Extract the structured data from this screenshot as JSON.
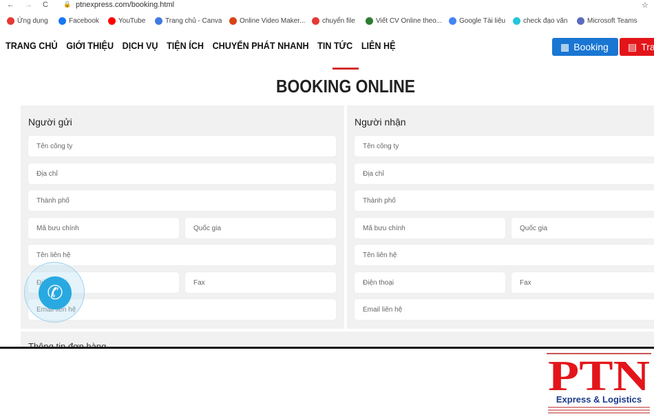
{
  "browser": {
    "url": "ptnexpress.com/booking.html"
  },
  "bookmarks": [
    {
      "label": "Ứng dụng",
      "color": "#e53935"
    },
    {
      "label": "Facebook",
      "color": "#1877f2"
    },
    {
      "label": "YouTube",
      "color": "#ff0000"
    },
    {
      "label": "Trang chủ - Canva",
      "color": "#3f7be0"
    },
    {
      "label": "Online Video Maker...",
      "color": "#d84315"
    },
    {
      "label": "chuyển file",
      "color": "#e53935"
    },
    {
      "label": "Viết CV Online theo...",
      "color": "#2e7d32"
    },
    {
      "label": "Google Tài liệu",
      "color": "#4285f4"
    },
    {
      "label": "check đạo văn",
      "color": "#26c6da"
    },
    {
      "label": "Microsoft Teams",
      "color": "#5c6bc0"
    }
  ],
  "nav": [
    "TRANG CHỦ",
    "GIỚI THIỆU",
    "DỊCH VỤ",
    "TIỆN ÍCH",
    "CHUYỂN PHÁT NHANH",
    "TIN TỨC",
    "LIÊN HỆ"
  ],
  "buttons": {
    "booking": "Booking",
    "track": "Tra"
  },
  "page_title": "BOOKING ONLINE",
  "sender": {
    "title": "Người gửi",
    "company": "Tên công ty",
    "address": "Địa chỉ",
    "city": "Thành phố",
    "postal": "Mã bưu chính",
    "country": "Quốc gia",
    "contact": "Tên liên hệ",
    "phone": "Điện thoại",
    "fax": "Fax",
    "email": "Email liên hệ"
  },
  "receiver": {
    "title": "Người nhận",
    "company": "Tên công ty",
    "address": "Địa chỉ",
    "city": "Thành phố",
    "postal": "Mã bưu chính",
    "country": "Quốc gia",
    "contact": "Tên liên hệ",
    "phone": "Điện thoại",
    "fax": "Fax",
    "email": "Email liên hệ"
  },
  "order_section": "Thông tin đơn hàng",
  "logo": {
    "name": "PTN",
    "tagline": "Express & Logistics"
  },
  "colors": {
    "accent": "#d32f2f",
    "booking": "#1976d2",
    "track": "#e3151a"
  }
}
